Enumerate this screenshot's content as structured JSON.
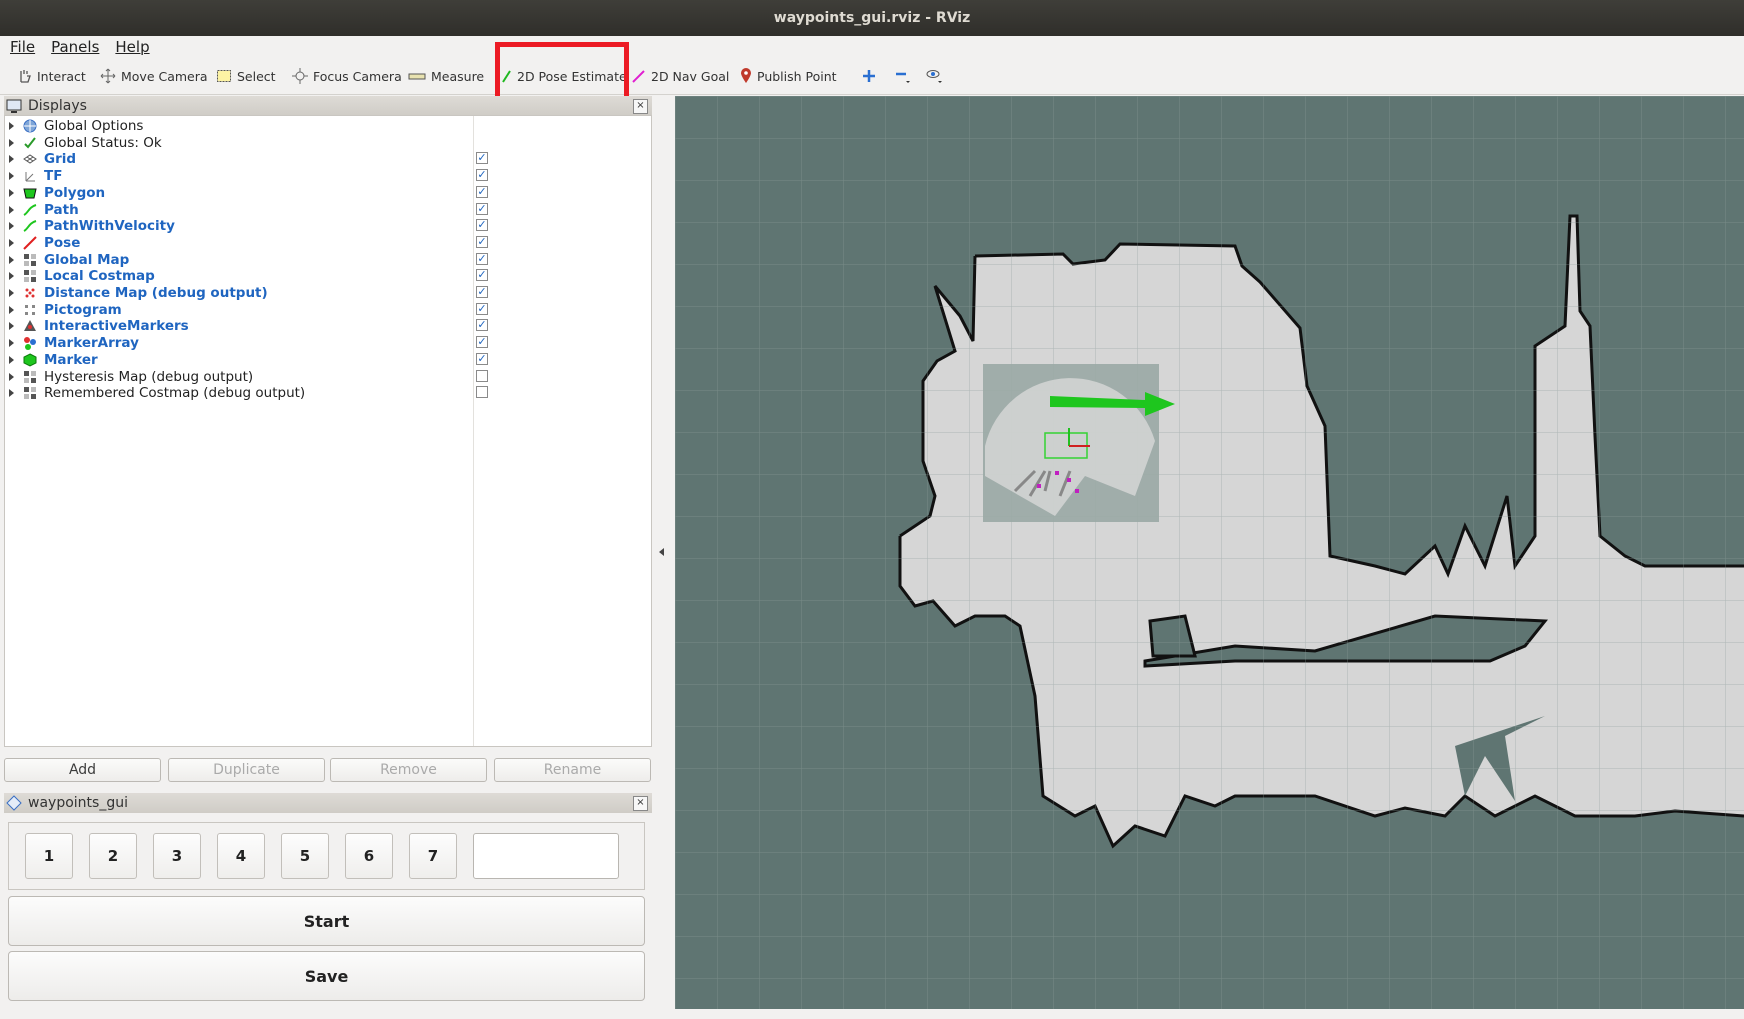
{
  "window": {
    "title": "waypoints_gui.rviz - RViz"
  },
  "menu": {
    "file": "File",
    "panels": "Panels",
    "help": "Help"
  },
  "toolbar": {
    "interact": "Interact",
    "move_camera": "Move Camera",
    "select": "Select",
    "focus_camera": "Focus Camera",
    "measure": "Measure",
    "pose_estimate": "2D Pose Estimate",
    "nav_goal": "2D Nav Goal",
    "publish_point": "Publish Point"
  },
  "displays_panel": {
    "title": "Displays",
    "items": [
      {
        "label": "Global Options",
        "style": "plain",
        "icon": "globe-icon",
        "checked": null
      },
      {
        "label": "Global Status: Ok",
        "style": "plain",
        "icon": "check-icon",
        "checked": null
      },
      {
        "label": "Grid",
        "style": "blue",
        "icon": "grid-icon",
        "checked": true
      },
      {
        "label": "TF",
        "style": "blue",
        "icon": "tf-icon",
        "checked": true
      },
      {
        "label": "Polygon",
        "style": "blue",
        "icon": "polygon-icon",
        "checked": true
      },
      {
        "label": "Path",
        "style": "blue",
        "icon": "path-icon",
        "checked": true
      },
      {
        "label": "PathWithVelocity",
        "style": "blue",
        "icon": "path-icon",
        "checked": true
      },
      {
        "label": "Pose",
        "style": "blue",
        "icon": "pose-icon",
        "checked": true
      },
      {
        "label": "Global Map",
        "style": "blue",
        "icon": "map-icon",
        "checked": true
      },
      {
        "label": "Local Costmap",
        "style": "blue",
        "icon": "map-icon",
        "checked": true
      },
      {
        "label": "Distance Map (debug output)",
        "style": "blue",
        "icon": "distance-map-icon",
        "checked": true
      },
      {
        "label": "Pictogram",
        "style": "blue",
        "icon": "pictogram-icon",
        "checked": true
      },
      {
        "label": "InteractiveMarkers",
        "style": "blue",
        "icon": "interactive-markers-icon",
        "checked": true
      },
      {
        "label": "MarkerArray",
        "style": "blue",
        "icon": "marker-array-icon",
        "checked": true
      },
      {
        "label": "Marker",
        "style": "blue",
        "icon": "marker-icon",
        "checked": true
      },
      {
        "label": "Hysteresis Map (debug output)",
        "style": "plain",
        "icon": "map-icon",
        "checked": false
      },
      {
        "label": "Remembered Costmap (debug output)",
        "style": "plain",
        "icon": "map-icon",
        "checked": false
      }
    ],
    "buttons": {
      "add": "Add",
      "duplicate": "Duplicate",
      "remove": "Remove",
      "rename": "Rename"
    }
  },
  "waypoints_panel": {
    "title": "waypoints_gui",
    "numbers": [
      "1",
      "2",
      "3",
      "4",
      "5",
      "6",
      "7"
    ],
    "input_value": "",
    "start": "Start",
    "save": "Save"
  },
  "colors": {
    "highlight": "#ec1b24",
    "map_background": "#5f7572",
    "free_space": "#d6d6d6",
    "pose_arrow": "#1ec61e"
  }
}
